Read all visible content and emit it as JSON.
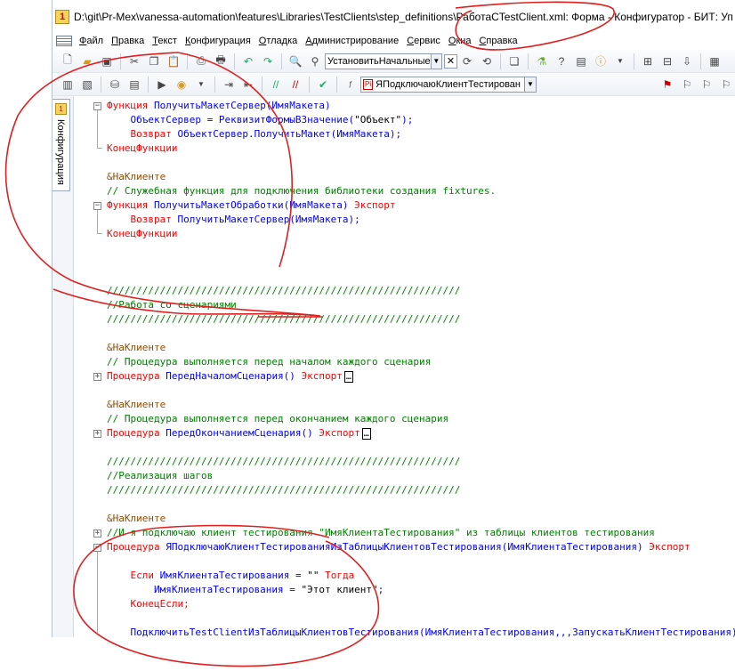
{
  "window": {
    "title": "D:\\git\\Pr-Mex\\vanessa-automation\\features\\Libraries\\TestClients\\step_definitions\\РаботаСTestClient.xml: Форма - Конфигуратор - БИТ: Уп"
  },
  "menu": {
    "items": [
      "Файл",
      "Правка",
      "Текст",
      "Конфигурация",
      "Отладка",
      "Администрирование",
      "Сервис",
      "Окна",
      "Справка"
    ]
  },
  "toolbar1": {
    "search_combo_value": "УстановитьНачальные",
    "icons": [
      "new-document-icon",
      "open-folder-icon",
      "save-icon",
      "cut-icon",
      "copy-icon",
      "paste-icon",
      "print-icon",
      "print-preview-icon",
      "undo-icon",
      "redo-icon",
      "search-icon",
      "find-icon",
      "find-next-icon",
      "find-previous-icon",
      "window-icon",
      "wizard-icon",
      "help-search-icon",
      "info-icon"
    ]
  },
  "toolbar2": {
    "procedure_combo_value": "ЯПодключаюКлиентТестирован",
    "procedure_combo_badge": "Pi"
  },
  "sidebar": {
    "tab_label": "Конфигурация"
  },
  "code": {
    "lines": [
      {
        "fold": "minus",
        "tokens": [
          {
            "t": "Функция ",
            "c": "kw"
          },
          {
            "t": "ПолучитьМакетСервер(ИмяМакета)",
            "c": "id"
          }
        ]
      },
      {
        "fold": "",
        "tokens": [
          {
            "t": "    ОбъектСервер = РеквизитФормыВЗначение(",
            "c": "id"
          },
          {
            "t": "\"Объект\"",
            "c": "st"
          },
          {
            "t": ");",
            "c": "id"
          }
        ]
      },
      {
        "fold": "",
        "tokens": [
          {
            "t": "    ",
            "c": "id"
          },
          {
            "t": "Возврат ",
            "c": "kw"
          },
          {
            "t": "ОбъектСервер.ПолучитьМакет(ИмяМакета);",
            "c": "id"
          }
        ]
      },
      {
        "fold": "end",
        "tokens": [
          {
            "t": "КонецФункции",
            "c": "kw"
          }
        ]
      },
      {
        "fold": "",
        "tokens": []
      },
      {
        "fold": "",
        "tokens": [
          {
            "t": "&НаКлиенте",
            "c": "dir"
          }
        ]
      },
      {
        "fold": "",
        "tokens": [
          {
            "t": "// Служебная функция для подключения библиотеки создания fixtures.",
            "c": "cm"
          }
        ]
      },
      {
        "fold": "minus",
        "tokens": [
          {
            "t": "Функция ",
            "c": "kw"
          },
          {
            "t": "ПолучитьМакетОбработки(ИмяМакета) ",
            "c": "id"
          },
          {
            "t": "Экспорт",
            "c": "kw"
          }
        ]
      },
      {
        "fold": "",
        "tokens": [
          {
            "t": "    ",
            "c": "id"
          },
          {
            "t": "Возврат ",
            "c": "kw"
          },
          {
            "t": "ПолучитьМакетСервер(ИмяМакета);",
            "c": "id"
          }
        ]
      },
      {
        "fold": "end",
        "tokens": [
          {
            "t": "КонецФункции",
            "c": "kw"
          }
        ]
      },
      {
        "fold": "",
        "tokens": []
      },
      {
        "fold": "",
        "tokens": []
      },
      {
        "fold": "",
        "tokens": []
      },
      {
        "fold": "",
        "tokens": [
          {
            "t": "////////////////////////////////////////////////////////////",
            "c": "cm"
          }
        ]
      },
      {
        "fold": "",
        "tokens": [
          {
            "t": "//Работа со сценариями",
            "c": "cm"
          }
        ]
      },
      {
        "fold": "",
        "tokens": [
          {
            "t": "////////////////////////////////////////////////////////////",
            "c": "cm"
          }
        ]
      },
      {
        "fold": "",
        "tokens": []
      },
      {
        "fold": "",
        "tokens": [
          {
            "t": "&НаКлиенте",
            "c": "dir"
          }
        ]
      },
      {
        "fold": "",
        "tokens": [
          {
            "t": "// Процедура выполняется перед началом каждого сценария",
            "c": "cm"
          }
        ]
      },
      {
        "fold": "plus",
        "ellipsis": true,
        "tokens": [
          {
            "t": "Процедура ",
            "c": "kw"
          },
          {
            "t": "ПередНачаломСценария() ",
            "c": "id"
          },
          {
            "t": "Экспорт",
            "c": "kw"
          }
        ]
      },
      {
        "fold": "",
        "tokens": []
      },
      {
        "fold": "",
        "tokens": [
          {
            "t": "&НаКлиенте",
            "c": "dir"
          }
        ]
      },
      {
        "fold": "",
        "tokens": [
          {
            "t": "// Процедура выполняется перед окончанием каждого сценария",
            "c": "cm"
          }
        ]
      },
      {
        "fold": "plus",
        "ellipsis": true,
        "tokens": [
          {
            "t": "Процедура ",
            "c": "kw"
          },
          {
            "t": "ПередОкончаниемСценария() ",
            "c": "id"
          },
          {
            "t": "Экспорт",
            "c": "kw"
          }
        ]
      },
      {
        "fold": "",
        "tokens": []
      },
      {
        "fold": "",
        "tokens": [
          {
            "t": "////////////////////////////////////////////////////////////",
            "c": "cm"
          }
        ]
      },
      {
        "fold": "",
        "tokens": [
          {
            "t": "//Реализация шагов",
            "c": "cm"
          }
        ]
      },
      {
        "fold": "",
        "tokens": [
          {
            "t": "////////////////////////////////////////////////////////////",
            "c": "cm"
          }
        ]
      },
      {
        "fold": "",
        "tokens": []
      },
      {
        "fold": "",
        "tokens": [
          {
            "t": "&НаКлиенте",
            "c": "dir"
          }
        ]
      },
      {
        "fold": "plus",
        "tokens": [
          {
            "t": "//И я подключаю клиент тестирования \"ИмяКлиентаТестирования\" из таблицы клиентов тестирования",
            "c": "cm"
          }
        ]
      },
      {
        "fold": "minus",
        "tokens": [
          {
            "t": "Процедура ",
            "c": "kw"
          },
          {
            "t": "ЯПодключаюКлиентТестированияИзТаблицыКлиентовТестирования(ИмяКлиентаТестирования) ",
            "c": "id"
          },
          {
            "t": "Экспорт",
            "c": "kw"
          }
        ]
      },
      {
        "fold": "",
        "tokens": []
      },
      {
        "fold": "",
        "tokens": [
          {
            "t": "    ",
            "c": "id"
          },
          {
            "t": "Если ",
            "c": "kw"
          },
          {
            "t": "ИмяКлиентаТестирования = ",
            "c": "id"
          },
          {
            "t": "\"\"",
            "c": "st"
          },
          {
            "t": " Тогда",
            "c": "kw"
          }
        ]
      },
      {
        "fold": "",
        "tokens": [
          {
            "t": "        ИмяКлиентаТестирования = ",
            "c": "id"
          },
          {
            "t": "\"Этот клиент\"",
            "c": "st"
          },
          {
            "t": ";",
            "c": "id"
          }
        ]
      },
      {
        "fold": "",
        "tokens": [
          {
            "t": "    ",
            "c": "id"
          },
          {
            "t": "КонецЕсли;",
            "c": "kw"
          }
        ]
      },
      {
        "fold": "",
        "tokens": []
      },
      {
        "fold": "",
        "tokens": [
          {
            "t": "    ПодключитьTestClientИзТаблицыКлиентовТестирования(ИмяКлиентаТестирования,,,ЗапускатьКлиентТестирования)",
            "c": "id"
          }
        ]
      }
    ]
  },
  "colors": {
    "keyword": "#ff0000",
    "identifier": "#0000ff",
    "comment": "#008000",
    "directive": "#964b00",
    "annotation_ink": "#e02020"
  }
}
